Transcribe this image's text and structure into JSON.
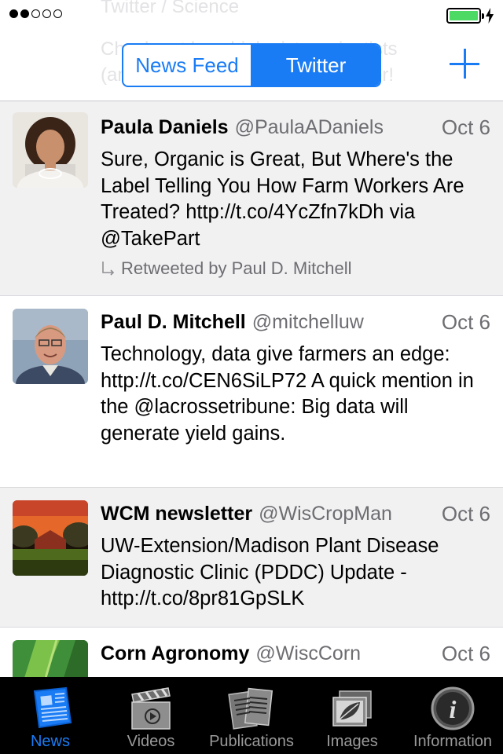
{
  "status_bar": {
    "signal_dots_filled": 2,
    "signal_dots_total": 5,
    "battery_level": 1.0,
    "battery_color": "#4cd964",
    "charging_icon": "bolt-icon"
  },
  "header": {
    "ghost_lines": [
      "Twitter / Science",
      "Check out how biologists, scientists",
      "(and economists) are using Twitter!"
    ],
    "segments": [
      "News Feed",
      "Twitter"
    ],
    "active_segment": "Twitter",
    "add_icon": "plus-icon",
    "accent_color": "#1a7cf5"
  },
  "tweets": [
    {
      "name": "Paula Daniels",
      "handle": "@PaulaADaniels",
      "date": "Oct 6",
      "text": "Sure, Organic is Great, But Where's the Label Telling You How Farm Workers Are Treated? http://t.co/4YcZfn7kDh via @TakePart",
      "retweet": "Retweeted by Paul D. Mitchell",
      "avatar_icon": "woman-portrait-avatar"
    },
    {
      "name": "Paul D. Mitchell",
      "handle": "@mitchelluw",
      "date": "Oct 6",
      "text": "Technology, data give farmers an edge: http://t.co/CEN6SiLP72  A quick mention in the @lacrossetribune: Big data will generate yield gains.",
      "avatar_icon": "man-portrait-avatar"
    },
    {
      "name": "WCM newsletter",
      "handle": "@WisCropMan",
      "date": "Oct 6",
      "text": "UW-Extension/Madison Plant Disease Diagnostic Clinic (PDDC) Update - http://t.co/8pr81GpSLK",
      "avatar_icon": "barn-sunset-avatar"
    },
    {
      "name": "Corn Agronomy",
      "handle": "@WiscCorn",
      "date": "Oct 6",
      "text": "",
      "avatar_icon": "corn-leaf-avatar"
    }
  ],
  "tabbar": {
    "tabs": [
      {
        "label": "News",
        "icon": "newspaper-icon",
        "active": true
      },
      {
        "label": "Videos",
        "icon": "clapperboard-icon",
        "active": false
      },
      {
        "label": "Publications",
        "icon": "documents-icon",
        "active": false
      },
      {
        "label": "Images",
        "icon": "leaf-photo-icon",
        "active": false
      },
      {
        "label": "Information",
        "icon": "info-icon",
        "active": false
      }
    ]
  }
}
